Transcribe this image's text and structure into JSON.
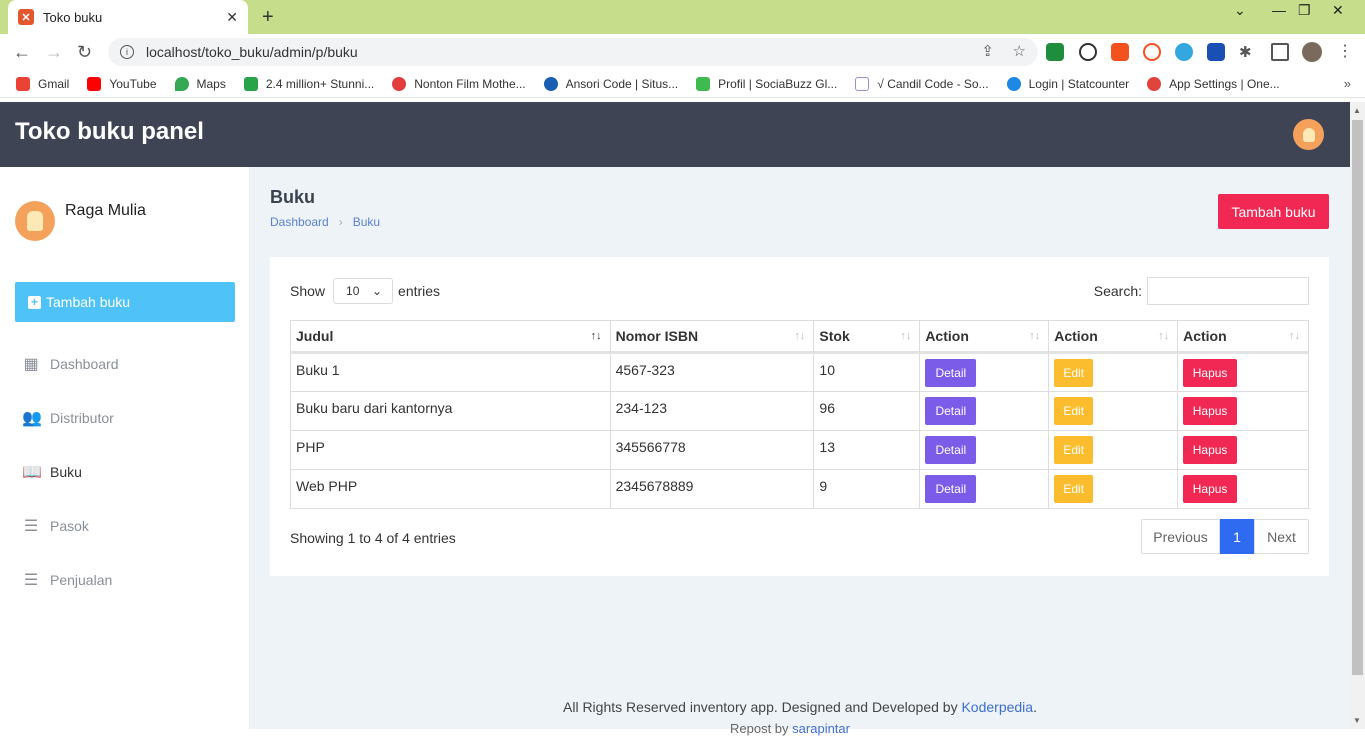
{
  "browser": {
    "tab_title": "Toko buku",
    "favicon": "xampp-icon",
    "url": "localhost/toko_buku/admin/p/buku",
    "bookmarks": [
      {
        "label": "Gmail",
        "color": "#ea4335"
      },
      {
        "label": "YouTube",
        "color": "#ff0000"
      },
      {
        "label": "Maps",
        "color": "#34a853"
      },
      {
        "label": "2.4 million+ Stunni...",
        "color": "#2aa24a"
      },
      {
        "label": "Nonton Film Mothe...",
        "color": "#e23c3c"
      },
      {
        "label": "Ansori Code | Situs...",
        "color": "#1a5fb4"
      },
      {
        "label": "Profil | SociaBuzz Gl...",
        "color": "#3fb950"
      },
      {
        "label": "√ Candil Code - So...",
        "color": "#9b8ccf"
      },
      {
        "label": "Login | Statcounter",
        "color": "#1e88e5"
      },
      {
        "label": "App Settings | One...",
        "color": "#e0443c"
      }
    ]
  },
  "header": {
    "title": "Toko buku panel"
  },
  "sidebar": {
    "user_name": "Raga Mulia",
    "add_button": "Tambah buku",
    "items": [
      {
        "label": "Dashboard",
        "icon": "dashboard-icon"
      },
      {
        "label": "Distributor",
        "icon": "people-icon"
      },
      {
        "label": "Buku",
        "icon": "book-icon",
        "active": true
      },
      {
        "label": "Pasok",
        "icon": "database-icon"
      },
      {
        "label": "Penjualan",
        "icon": "database-icon"
      }
    ]
  },
  "main": {
    "page_title": "Buku",
    "breadcrumb": [
      "Dashboard",
      "Buku"
    ],
    "add_button": "Tambah buku",
    "show_label": "Show",
    "entries_value": "10",
    "entries_label": "entries",
    "search_label": "Search:",
    "columns": [
      "Judul",
      "Nomor ISBN",
      "Stok",
      "Action",
      "Action",
      "Action"
    ],
    "rows": [
      {
        "judul": "Buku 1",
        "isbn": "4567-323",
        "stok": "10"
      },
      {
        "judul": "Buku baru dari kantornya",
        "isbn": "234-123",
        "stok": "96"
      },
      {
        "judul": "PHP",
        "isbn": "345566778",
        "stok": "13"
      },
      {
        "judul": "Web PHP",
        "isbn": "2345678889",
        "stok": "9"
      }
    ],
    "action_labels": {
      "detail": "Detail",
      "edit": "Edit",
      "hapus": "Hapus"
    },
    "info": "Showing 1 to 4 of 4 entries",
    "pager": {
      "prev": "Previous",
      "current": "1",
      "next": "Next"
    },
    "footer_text": "All Rights Reserved inventory app. Designed and Developed by",
    "footer_link": "Koderpedia",
    "footer_dot": ".",
    "footer2_text": "Repost by",
    "footer2_link": "sarapintar"
  }
}
